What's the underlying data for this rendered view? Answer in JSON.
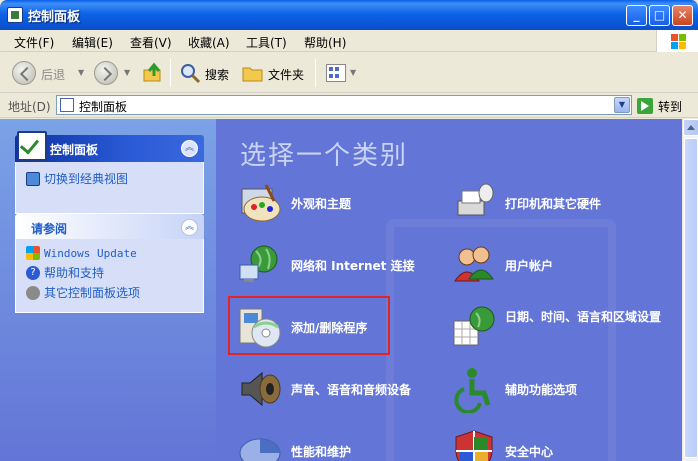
{
  "window": {
    "title": "控制面板"
  },
  "menu": [
    "文件(F)",
    "编辑(E)",
    "查看(V)",
    "收藏(A)",
    "工具(T)",
    "帮助(H)"
  ],
  "toolbar": {
    "back_label": "后退",
    "search_label": "搜索",
    "folders_label": "文件夹"
  },
  "address": {
    "label": "地址(D)",
    "value": "控制面板",
    "go_label": "转到"
  },
  "task_panel": {
    "title": "控制面板",
    "links": [
      {
        "label": "切换到经典视图",
        "icon": "classic-view-icon"
      }
    ]
  },
  "see_also": {
    "title": "请参阅",
    "links": [
      {
        "label": "Windows Update",
        "icon": "windows-update-icon"
      },
      {
        "label": "帮助和支持",
        "icon": "help-icon"
      },
      {
        "label": "其它控制面板选项",
        "icon": "gear-icon"
      }
    ]
  },
  "main": {
    "heading": "选择一个类别",
    "categories": [
      {
        "label": "外观和主题",
        "icon": "appearance-palette-icon"
      },
      {
        "label": "打印机和其它硬件",
        "icon": "printer-icon"
      },
      {
        "label": "网络和 Internet 连接",
        "icon": "network-globe-icon"
      },
      {
        "label": "用户帐户",
        "icon": "user-accounts-icon"
      },
      {
        "label": "添加/删除程序",
        "icon": "add-remove-programs-icon"
      },
      {
        "label": "日期、时间、语言和区域设置",
        "icon": "date-time-globe-icon"
      },
      {
        "label": "声音、语音和音频设备",
        "icon": "speaker-icon"
      },
      {
        "label": "辅助功能选项",
        "icon": "accessibility-icon"
      },
      {
        "label": "性能和维护",
        "icon": "performance-chart-icon"
      },
      {
        "label": "安全中心",
        "icon": "security-shield-icon"
      }
    ],
    "highlight_color": "#e0242a"
  },
  "colors": {
    "titlebar": "#0a55d8",
    "main_bg": "#6375d6",
    "link": "#215dc6"
  }
}
